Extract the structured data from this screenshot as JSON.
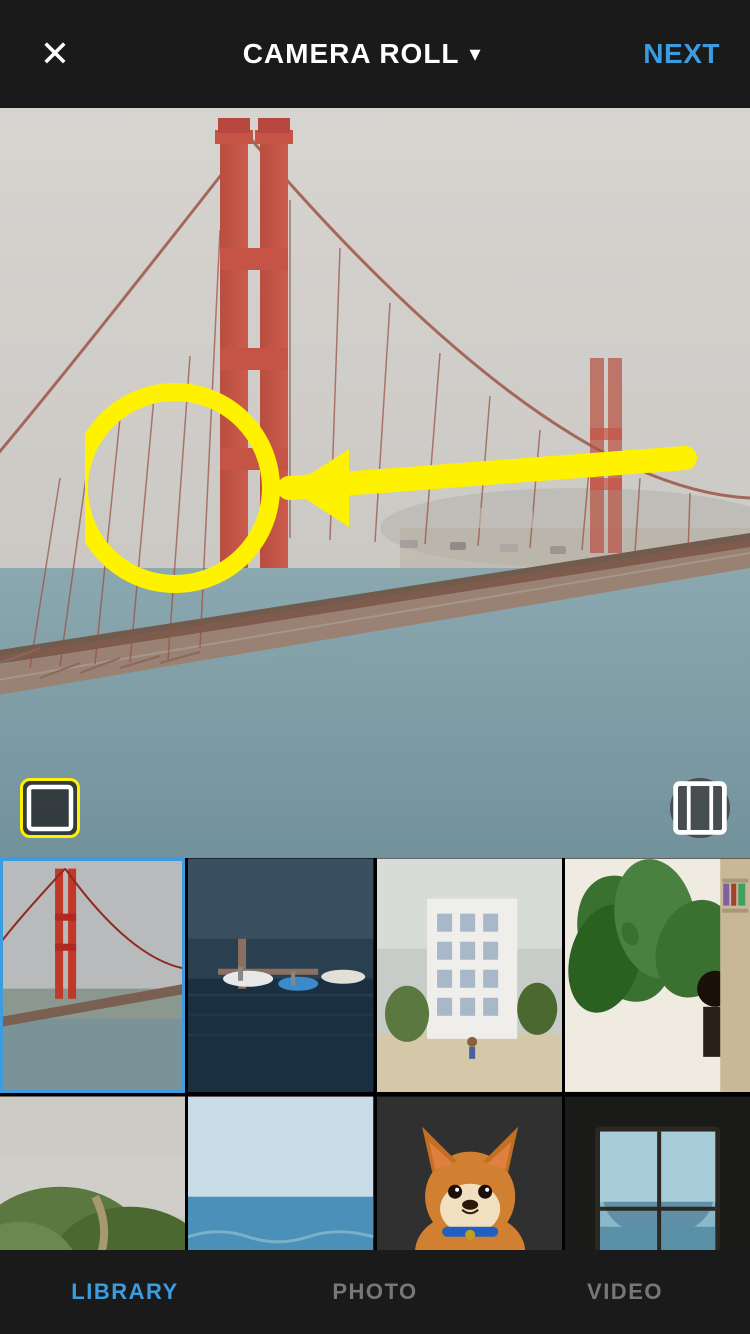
{
  "header": {
    "close_label": "✕",
    "title": "CAMERA ROLL",
    "chevron": "∨",
    "next_label": "NEXT"
  },
  "preview": {
    "crop_icon": "⌐",
    "format_icon": "⊞"
  },
  "thumbnails": [
    {
      "id": 1,
      "selected": true,
      "type": "bridge"
    },
    {
      "id": 2,
      "selected": false,
      "type": "marina"
    },
    {
      "id": 3,
      "selected": false,
      "type": "building"
    },
    {
      "id": 4,
      "selected": false,
      "type": "plants"
    },
    {
      "id": 5,
      "selected": false,
      "type": "hills"
    },
    {
      "id": 6,
      "selected": false,
      "type": "beach"
    },
    {
      "id": 7,
      "selected": false,
      "type": "dog"
    },
    {
      "id": 8,
      "selected": false,
      "type": "window"
    }
  ],
  "bottom_nav": {
    "items": [
      {
        "label": "LIBRARY",
        "active": true
      },
      {
        "label": "PHOTO",
        "active": false
      },
      {
        "label": "VIDEO",
        "active": false
      }
    ]
  }
}
